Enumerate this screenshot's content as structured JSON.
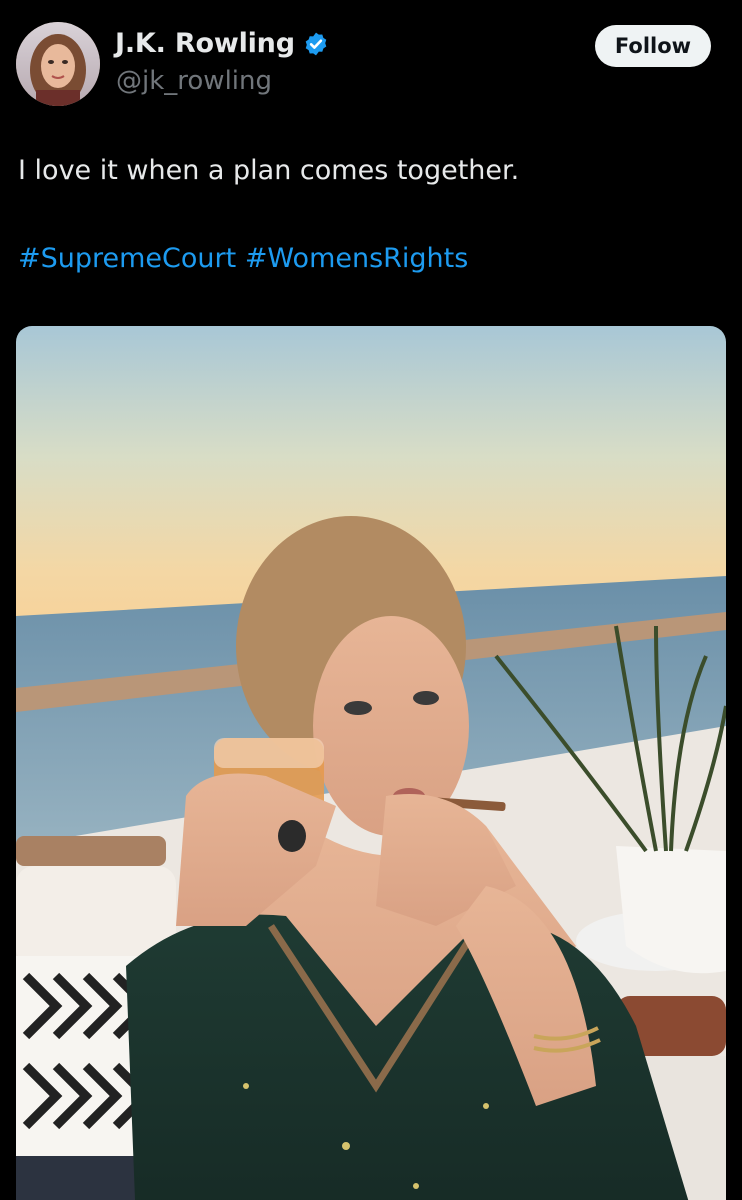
{
  "author": {
    "display_name": "J.K. Rowling",
    "handle": "@jk_rowling",
    "verified_icon": "verified-badge-icon",
    "avatar_icon": "profile-avatar"
  },
  "follow_button": {
    "label": "Follow"
  },
  "tweet": {
    "text": "I love it when a plan comes together.",
    "hashtags": [
      "#SupremeCourt",
      "#WomensRights"
    ]
  },
  "media": {
    "type": "photo",
    "description_icon": "tweet-photo"
  },
  "colors": {
    "background": "#000000",
    "text": "#e7e9ea",
    "secondary": "#71767b",
    "link": "#1d9bf0",
    "verified": "#1d9bf0"
  }
}
